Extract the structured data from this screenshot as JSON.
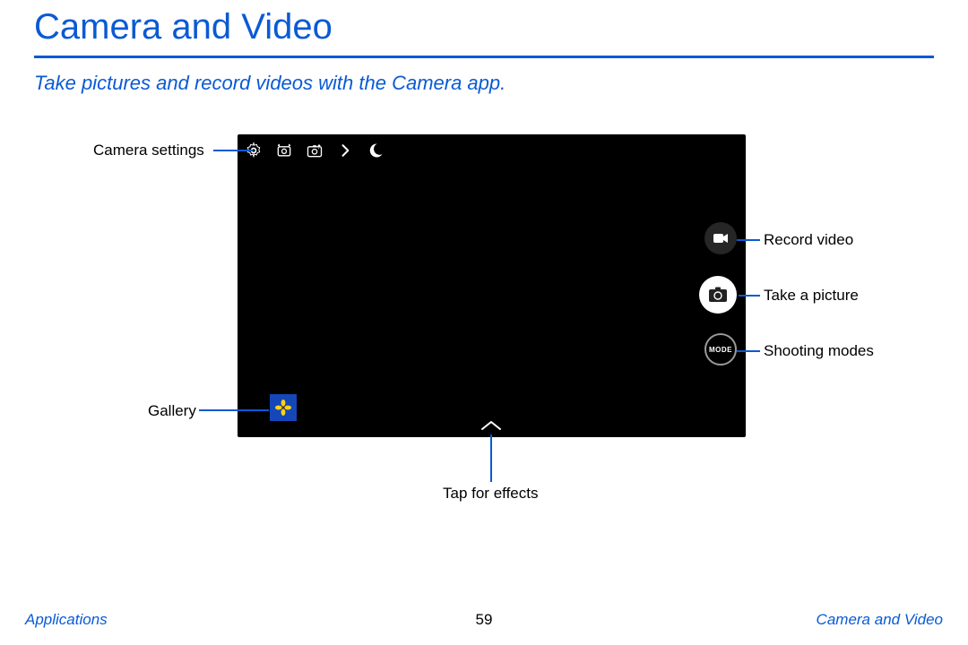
{
  "page": {
    "title": "Camera and Video",
    "subtitle": "Take pictures and record videos with the Camera app."
  },
  "viewfinder": {
    "mode_label": "MODE"
  },
  "callouts": {
    "settings": "Camera settings",
    "gallery": "Gallery",
    "effects": "Tap for effects",
    "record": "Record video",
    "picture": "Take a picture",
    "modes": "Shooting modes"
  },
  "footer": {
    "left": "Applications",
    "page_number": "59",
    "right": "Camera and Video"
  }
}
